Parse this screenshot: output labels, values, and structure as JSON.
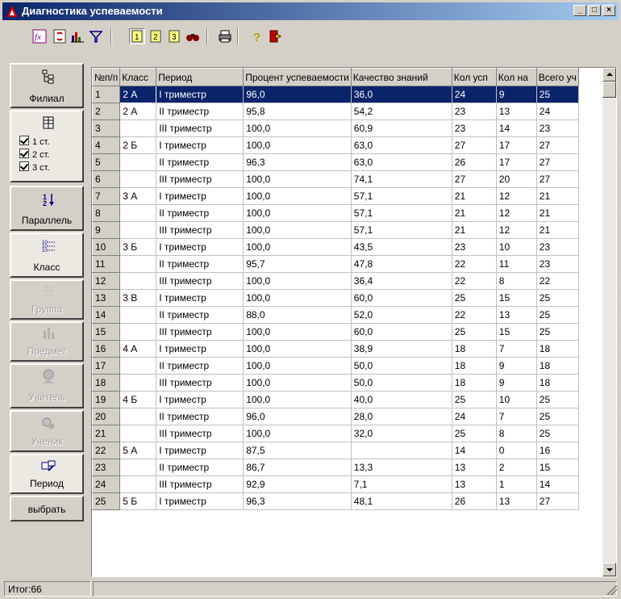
{
  "window": {
    "title": "Диагностика успеваемости",
    "controls": [
      "_",
      "□",
      "×"
    ]
  },
  "toolbar": {
    "icons": [
      "formula-icon",
      "refresh-icon",
      "chart-icon",
      "filter-icon",
      "page-1-icon",
      "page-2-icon",
      "page-3-icon",
      "binoculars-icon",
      "printer-icon",
      "help-icon",
      "exit-icon"
    ],
    "pages": [
      "1",
      "2",
      "3"
    ],
    "help_label": "?",
    "fx_label": "fx"
  },
  "left_panel": {
    "filial": "Филиал",
    "streams": [
      "1 ст.",
      "2 ст.",
      "3 ст."
    ],
    "parallel": "Параллель",
    "klass": "Класс",
    "gruppa": "Группа",
    "predmet": "Предмет",
    "uchitel": "Учитель",
    "uchenik": "Ученик",
    "period": "Период",
    "vybrat": "выбрать"
  },
  "grid": {
    "columns": [
      "№п/п",
      "Класс",
      "Период",
      "Процент успеваемости",
      "Качество знаний",
      "Кол усп",
      "Кол на",
      "Всего уч"
    ],
    "rows": [
      [
        "1",
        "2 А",
        "I триместр",
        "96,0",
        "36,0",
        "24",
        "9",
        "25"
      ],
      [
        "2",
        "2 А",
        "II триместр",
        "95,8",
        "54,2",
        "23",
        "13",
        "24"
      ],
      [
        "3",
        "",
        "III триместр",
        "100,0",
        "60,9",
        "23",
        "14",
        "23"
      ],
      [
        "4",
        "2 Б",
        "I триместр",
        "100,0",
        "63,0",
        "27",
        "17",
        "27"
      ],
      [
        "5",
        "",
        "II триместр",
        "96,3",
        "63,0",
        "26",
        "17",
        "27"
      ],
      [
        "6",
        "",
        "III триместр",
        "100,0",
        "74,1",
        "27",
        "20",
        "27"
      ],
      [
        "7",
        "3 А",
        "I триместр",
        "100,0",
        "57,1",
        "21",
        "12",
        "21"
      ],
      [
        "8",
        "",
        "II триместр",
        "100,0",
        "57,1",
        "21",
        "12",
        "21"
      ],
      [
        "9",
        "",
        "III триместр",
        "100,0",
        "57,1",
        "21",
        "12",
        "21"
      ],
      [
        "10",
        "3 Б",
        "I триместр",
        "100,0",
        "43,5",
        "23",
        "10",
        "23"
      ],
      [
        "11",
        "",
        "II триместр",
        "95,7",
        "47,8",
        "22",
        "11",
        "23"
      ],
      [
        "12",
        "",
        "III триместр",
        "100,0",
        "36,4",
        "22",
        "8",
        "22"
      ],
      [
        "13",
        "3 В",
        "I триместр",
        "100,0",
        "60,0",
        "25",
        "15",
        "25"
      ],
      [
        "14",
        "",
        "II триместр",
        "88,0",
        "52,0",
        "22",
        "13",
        "25"
      ],
      [
        "15",
        "",
        "III триместр",
        "100,0",
        "60,0",
        "25",
        "15",
        "25"
      ],
      [
        "16",
        "4 А",
        "I триместр",
        "100,0",
        "38,9",
        "18",
        "7",
        "18"
      ],
      [
        "17",
        "",
        "II триместр",
        "100,0",
        "50,0",
        "18",
        "9",
        "18"
      ],
      [
        "18",
        "",
        "III триместр",
        "100,0",
        "50,0",
        "18",
        "9",
        "18"
      ],
      [
        "19",
        "4 Б",
        "I триместр",
        "100,0",
        "40,0",
        "25",
        "10",
        "25"
      ],
      [
        "20",
        "",
        "II триместр",
        "96,0",
        "28,0",
        "24",
        "7",
        "25"
      ],
      [
        "21",
        "",
        "III триместр",
        "100,0",
        "32,0",
        "25",
        "8",
        "25"
      ],
      [
        "22",
        "5 А",
        "I триместр",
        "87,5",
        "",
        "14",
        "0",
        "16"
      ],
      [
        "23",
        "",
        "II триместр",
        "86,7",
        "13,3",
        "13",
        "2",
        "15"
      ],
      [
        "24",
        "",
        "III триместр",
        "92,9",
        "7,1",
        "13",
        "1",
        "14"
      ],
      [
        "25",
        "5 Б",
        "I триместр",
        "96,3",
        "48,1",
        "26",
        "13",
        "27"
      ]
    ]
  },
  "status": {
    "total": "Итог:66"
  }
}
